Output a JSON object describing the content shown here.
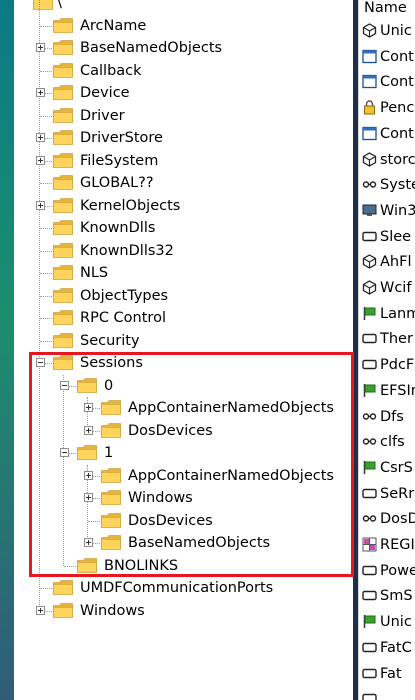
{
  "tree": {
    "root_label": "\\",
    "items": [
      {
        "label": "ArcName",
        "expandable": false
      },
      {
        "label": "BaseNamedObjects",
        "expandable": true
      },
      {
        "label": "Callback",
        "expandable": false
      },
      {
        "label": "Device",
        "expandable": true
      },
      {
        "label": "Driver",
        "expandable": false
      },
      {
        "label": "DriverStore",
        "expandable": true
      },
      {
        "label": "FileSystem",
        "expandable": true
      },
      {
        "label": "GLOBAL??",
        "expandable": false
      },
      {
        "label": "KernelObjects",
        "expandable": true
      },
      {
        "label": "KnownDlls",
        "expandable": false
      },
      {
        "label": "KnownDlls32",
        "expandable": false
      },
      {
        "label": "NLS",
        "expandable": false
      },
      {
        "label": "ObjectTypes",
        "expandable": false
      },
      {
        "label": "RPC Control",
        "expandable": false
      },
      {
        "label": "Security",
        "expandable": false
      },
      {
        "label": "Sessions",
        "expandable": true,
        "expanded": true
      },
      {
        "label": "0",
        "expandable": true,
        "expanded": true
      },
      {
        "label": "AppContainerNamedObjects",
        "expandable": true
      },
      {
        "label": "DosDevices",
        "expandable": true
      },
      {
        "label": "1",
        "expandable": true,
        "expanded": true
      },
      {
        "label": "AppContainerNamedObjects",
        "expandable": true
      },
      {
        "label": "Windows",
        "expandable": true
      },
      {
        "label": "DosDevices",
        "expandable": false
      },
      {
        "label": "BaseNamedObjects",
        "expandable": true
      },
      {
        "label": "BNOLINKS",
        "expandable": false
      },
      {
        "label": "UMDFCommunicationPorts",
        "expandable": false
      },
      {
        "label": "Windows",
        "expandable": true
      }
    ]
  },
  "list": {
    "column_header": "Name",
    "items": [
      {
        "label": "Unic",
        "icon": "hexagon-icon"
      },
      {
        "label": "Cont",
        "icon": "window-icon"
      },
      {
        "label": "Cont",
        "icon": "window-icon"
      },
      {
        "label": "Penc",
        "icon": "lock-icon"
      },
      {
        "label": "Cont",
        "icon": "window-icon"
      },
      {
        "label": "storc",
        "icon": "hexagon-icon"
      },
      {
        "label": "Syste",
        "icon": "link-icon"
      },
      {
        "label": "Win3",
        "icon": "monitor-icon"
      },
      {
        "label": "Slee",
        "icon": "rect-icon"
      },
      {
        "label": "AhFl",
        "icon": "hexagon-icon"
      },
      {
        "label": "Wcif",
        "icon": "hexagon-icon"
      },
      {
        "label": "Lanm",
        "icon": "flag-icon"
      },
      {
        "label": "Ther",
        "icon": "rect-icon"
      },
      {
        "label": "PdcF",
        "icon": "rect-icon"
      },
      {
        "label": "EFSIn",
        "icon": "flag-icon"
      },
      {
        "label": "Dfs",
        "icon": "link-icon"
      },
      {
        "label": "clfs",
        "icon": "link-icon"
      },
      {
        "label": "CsrS",
        "icon": "flag-icon"
      },
      {
        "label": "SeRr",
        "icon": "rect-icon"
      },
      {
        "label": "DosD",
        "icon": "link-icon"
      },
      {
        "label": "REGI",
        "icon": "grid-icon"
      },
      {
        "label": "Powe",
        "icon": "rect-icon"
      },
      {
        "label": "SmS",
        "icon": "rect-icon"
      },
      {
        "label": "Unic",
        "icon": "flag-icon"
      },
      {
        "label": "FatC",
        "icon": "rect-icon"
      },
      {
        "label": "Fat",
        "icon": "rect-icon"
      },
      {
        "label": "",
        "icon": "rect-icon"
      }
    ]
  },
  "colors": {
    "highlight": "#e8161e",
    "folder_back": "#e9b43b",
    "folder_front": "#ffd45c",
    "splitter": "#1f2f4a"
  }
}
